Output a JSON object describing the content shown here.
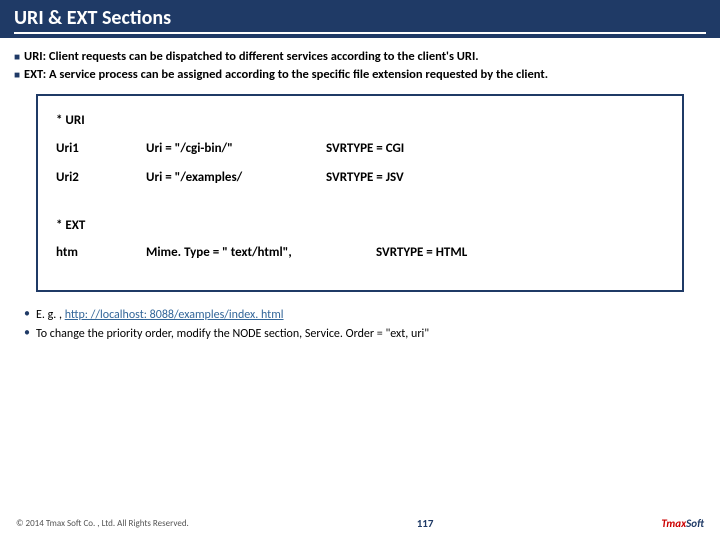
{
  "header": {
    "title": "URI & EXT Sections"
  },
  "intro": {
    "line1": "URI: Client requests can be dispatched to different services according to the client's URI.",
    "line2": "EXT: A service process can be assigned according to the specific file extension requested by the client."
  },
  "box": {
    "uri_head": "* URI",
    "uri_rows": [
      {
        "name": "Uri1",
        "def": "Uri = \"/cgi-bin/\"",
        "svr": "SVRTYPE = CGI"
      },
      {
        "name": "Uri2",
        "def": "Uri = \"/examples/",
        "svr": "SVRTYPE = JSV"
      }
    ],
    "ext_head": "* EXT",
    "ext_row": {
      "name": "htm",
      "def": "Mime. Type = \" text/html\",",
      "svr": "SVRTYPE = HTML"
    }
  },
  "notes": {
    "n1_prefix": "E. g. , ",
    "n1_link": "http: //localhost: 8088/examples/index. html",
    "n2": "To change the priority order, modify the NODE section, Service. Order = \"ext, uri\""
  },
  "footer": {
    "copyright": "© 2014 Tmax Soft Co. , Ltd. All Rights Reserved.",
    "page": "117",
    "logo_l": "Tmax",
    "logo_r": "Soft"
  }
}
